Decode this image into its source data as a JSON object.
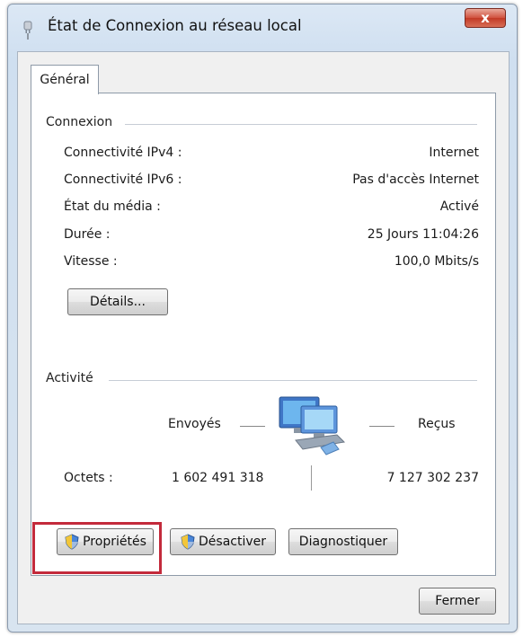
{
  "window": {
    "title": "État de Connexion au réseau local",
    "close_label": "x"
  },
  "tabs": [
    {
      "label": "Général"
    }
  ],
  "connexion": {
    "heading": "Connexion",
    "rows": [
      {
        "label": "Connectivité IPv4 :",
        "value": "Internet"
      },
      {
        "label": "Connectivité IPv6 :",
        "value": "Pas d'accès Internet"
      },
      {
        "label": "État du média :",
        "value": "Activé"
      },
      {
        "label": "Durée :",
        "value": "25 Jours 11:04:26"
      },
      {
        "label": "Vitesse :",
        "value": "100,0 Mbits/s"
      }
    ],
    "details_button": "Détails..."
  },
  "activite": {
    "heading": "Activité",
    "sent_label": "Envoyés",
    "received_label": "Reçus",
    "bytes_label": "Octets :",
    "bytes_sent": "1 602 491 318",
    "bytes_received": "7 127 302 237"
  },
  "buttons": {
    "properties": "Propriétés",
    "disable": "Désactiver",
    "diagnose": "Diagnostiquer",
    "close": "Fermer"
  },
  "icons": {
    "title": "network-plug-icon",
    "activity": "network-computers-icon",
    "uac": "uac-shield-icon"
  },
  "colors": {
    "highlight_box": "#c32a3b",
    "close_button": "#c9422e"
  }
}
